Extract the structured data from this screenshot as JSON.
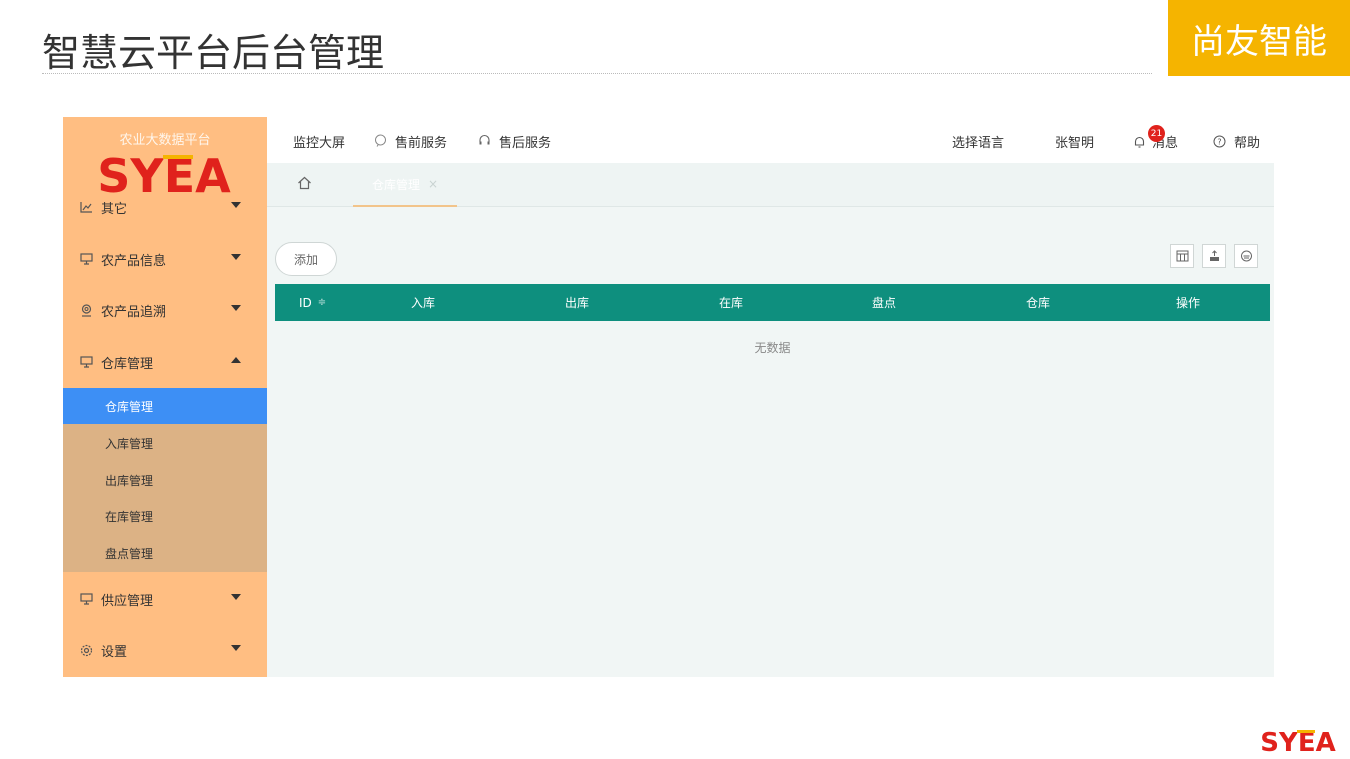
{
  "slide": {
    "title": "智慧云平台后台管理",
    "brand_badge": "尚友智能",
    "logo_text": "SYEA"
  },
  "sidebar": {
    "platform_name": "农业大数据平台",
    "logo_text": "SYEA",
    "items": [
      {
        "label": "其它",
        "icon": "chart-icon",
        "expanded": false
      },
      {
        "label": "农产品信息",
        "icon": "monitor-icon",
        "expanded": false
      },
      {
        "label": "农产品追溯",
        "icon": "location-icon",
        "expanded": false
      },
      {
        "label": "仓库管理",
        "icon": "monitor-icon",
        "expanded": true
      },
      {
        "label": "供应管理",
        "icon": "monitor-icon",
        "expanded": false
      },
      {
        "label": "设置",
        "icon": "gear-icon",
        "expanded": false
      }
    ],
    "sub_items": [
      "仓库管理",
      "入库管理",
      "出库管理",
      "在库管理",
      "盘点管理"
    ],
    "active_sub": "仓库管理"
  },
  "topbar": {
    "left": [
      {
        "label": "监控大屏",
        "icon": ""
      },
      {
        "label": "售前服务",
        "icon": "chat-icon"
      },
      {
        "label": "售后服务",
        "icon": "headset-icon"
      }
    ],
    "language": "选择语言",
    "user": "张智明",
    "messages": {
      "label": "消息",
      "count": "21"
    },
    "help": "帮助"
  },
  "tabs": {
    "active_tab": "仓库管理",
    "close": "×"
  },
  "toolbar": {
    "add_label": "添加"
  },
  "table": {
    "columns": [
      "ID",
      "入库",
      "出库",
      "在库",
      "盘点",
      "仓库",
      "操作"
    ],
    "sort_symbol": "≑",
    "empty_text": "无数据"
  },
  "colors": {
    "sidebar_bg": "#ffbe82",
    "submenu_bg": "#dcb285",
    "active_item": "#3d8ff5",
    "table_header": "#0e8f7e",
    "brand_badge": "#f5b400",
    "logo_red": "#e0221c",
    "logo_yellow": "#f5b400",
    "badge_red": "#e0221c"
  }
}
